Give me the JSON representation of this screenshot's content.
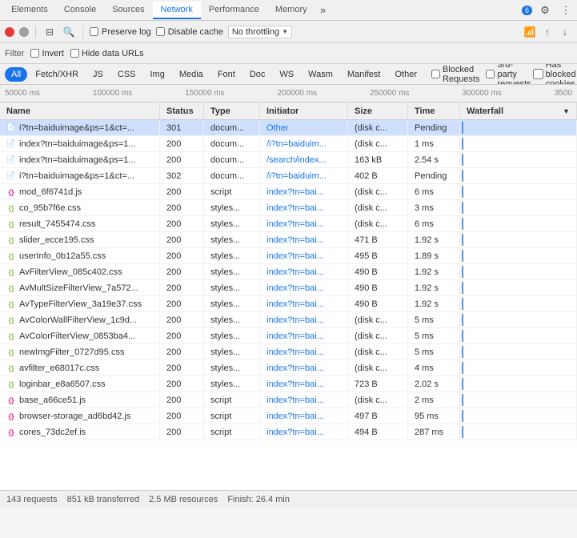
{
  "tabs": {
    "items": [
      {
        "label": "Elements",
        "active": false
      },
      {
        "label": "Console",
        "active": false
      },
      {
        "label": "Sources",
        "active": false
      },
      {
        "label": "Network",
        "active": true
      },
      {
        "label": "Performance",
        "active": false
      },
      {
        "label": "Memory",
        "active": false
      }
    ],
    "more_label": "»",
    "badge": "6",
    "settings_icon": "⚙",
    "more_icon": "⋮",
    "dock_icon": "⊡",
    "undock_icon": "⊞"
  },
  "toolbar": {
    "record_stop": "●",
    "clear": "🚫",
    "filter_icon": "⊟",
    "search_icon": "🔍",
    "preserve_log_label": "Preserve log",
    "disable_cache_label": "Disable cache",
    "no_throttling_label": "No throttling",
    "online_icon": "📶",
    "upload_icon": "↑",
    "download_icon": "↓"
  },
  "filter_bar": {
    "label": "Filter",
    "invert_label": "Invert",
    "hide_data_urls_label": "Hide data URLs"
  },
  "type_bar": {
    "types": [
      "All",
      "Fetch/XHR",
      "JS",
      "CSS",
      "Img",
      "Media",
      "Font",
      "Doc",
      "WS",
      "Wasm",
      "Manifest",
      "Other"
    ],
    "active": "All",
    "blocked_requests_label": "Blocked Requests",
    "third_party_label": "3rd-party requests",
    "has_blocked_cookies_label": "Has blocked cookies"
  },
  "timeline": {
    "scale": [
      "50000 ms",
      "100000 ms",
      "150000 ms",
      "200000 ms",
      "250000 ms",
      "300000 ms",
      "3500"
    ]
  },
  "table": {
    "headers": [
      "Name",
      "Status",
      "Type",
      "Initiator",
      "Size",
      "Time",
      "Waterfall"
    ],
    "rows": [
      {
        "name": "i?tn=baiduimage&ps=1&ct=...",
        "status": "301",
        "type": "docum...",
        "initiator": "Other",
        "size": "(disk c...",
        "time": "Pending",
        "icon": "doc",
        "selected": true
      },
      {
        "name": "index?tn=baiduimage&ps=1...",
        "status": "200",
        "type": "docum...",
        "initiator": "/i?tn=baiduim...",
        "size": "(disk c...",
        "time": "1 ms",
        "icon": "doc"
      },
      {
        "name": "index?tn=baiduimage&ps=1...",
        "status": "200",
        "type": "docum...",
        "initiator": "/search/index...",
        "size": "163 kB",
        "time": "2.54 s",
        "icon": "doc"
      },
      {
        "name": "i?tn=baiduimage&ps=1&ct=...",
        "status": "302",
        "type": "docum...",
        "initiator": "/i?tn=baiduim...",
        "size": "402 B",
        "time": "Pending",
        "icon": "doc"
      },
      {
        "name": "mod_6f6741d.js",
        "status": "200",
        "type": "script",
        "initiator": "index?tn=bai...",
        "size": "(disk c...",
        "time": "6 ms",
        "icon": "script"
      },
      {
        "name": "co_95b7f6e.css",
        "status": "200",
        "type": "styles...",
        "initiator": "index?tn=bai...",
        "size": "(disk c...",
        "time": "3 ms",
        "icon": "style"
      },
      {
        "name": "result_7455474.css",
        "status": "200",
        "type": "styles...",
        "initiator": "index?tn=bai...",
        "size": "(disk c...",
        "time": "6 ms",
        "icon": "style"
      },
      {
        "name": "slider_ecce195.css",
        "status": "200",
        "type": "styles...",
        "initiator": "index?tn=bai...",
        "size": "471 B",
        "time": "1.92 s",
        "icon": "style"
      },
      {
        "name": "userInfo_0b12a55.css",
        "status": "200",
        "type": "styles...",
        "initiator": "index?tn=bai...",
        "size": "495 B",
        "time": "1.89 s",
        "icon": "style"
      },
      {
        "name": "AvFilterView_085c402.css",
        "status": "200",
        "type": "styles...",
        "initiator": "index?tn=bai...",
        "size": "490 B",
        "time": "1.92 s",
        "icon": "style"
      },
      {
        "name": "AvMultSizeFilterView_7a572...",
        "status": "200",
        "type": "styles...",
        "initiator": "index?tn=bai...",
        "size": "490 B",
        "time": "1.92 s",
        "icon": "style"
      },
      {
        "name": "AvTypeFilterView_3a19e37.css",
        "status": "200",
        "type": "styles...",
        "initiator": "index?tn=bai...",
        "size": "490 B",
        "time": "1.92 s",
        "icon": "style"
      },
      {
        "name": "AvColorWallFilterView_1c9d...",
        "status": "200",
        "type": "styles...",
        "initiator": "index?tn=bai...",
        "size": "(disk c...",
        "time": "5 ms",
        "icon": "style"
      },
      {
        "name": "AvColorFilterView_0853ba4...",
        "status": "200",
        "type": "styles...",
        "initiator": "index?tn=bai...",
        "size": "(disk c...",
        "time": "5 ms",
        "icon": "style"
      },
      {
        "name": "newImgFilter_0727d95.css",
        "status": "200",
        "type": "styles...",
        "initiator": "index?tn=bai...",
        "size": "(disk c...",
        "time": "5 ms",
        "icon": "style"
      },
      {
        "name": "avfilter_e68017c.css",
        "status": "200",
        "type": "styles...",
        "initiator": "index?tn=bai...",
        "size": "(disk c...",
        "time": "4 ms",
        "icon": "style"
      },
      {
        "name": "loginbar_e8a6507.css",
        "status": "200",
        "type": "styles...",
        "initiator": "index?tn=bai...",
        "size": "723 B",
        "time": "2.02 s",
        "icon": "style"
      },
      {
        "name": "base_a66ce51.js",
        "status": "200",
        "type": "script",
        "initiator": "index?tn=bai...",
        "size": "(disk c...",
        "time": "2 ms",
        "icon": "script"
      },
      {
        "name": "browser-storage_ad6bd42.js",
        "status": "200",
        "type": "script",
        "initiator": "index?tn=bai...",
        "size": "497 B",
        "time": "95 ms",
        "icon": "script"
      },
      {
        "name": "cores_73dc2ef.is",
        "status": "200",
        "type": "script",
        "initiator": "index?tn=bai...",
        "size": "494 B",
        "time": "287 ms",
        "icon": "script"
      }
    ]
  },
  "status_bar": {
    "requests": "143 requests",
    "transferred": "851 kB transferred",
    "resources": "2.5 MB resources",
    "finish": "Finish: 26.4 min"
  }
}
